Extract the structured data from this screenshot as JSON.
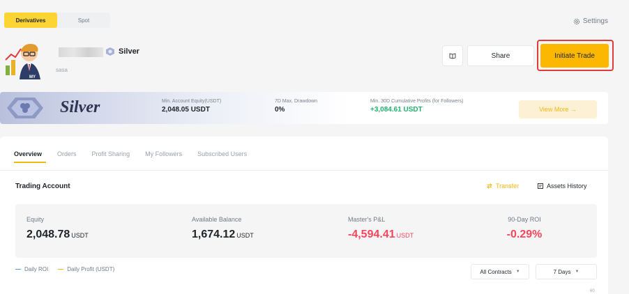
{
  "account_toggle": {
    "options": [
      "Derivatives",
      "Spot"
    ],
    "selected": "Derivatives"
  },
  "header": {
    "settings_label": "Settings",
    "user_tier": "Silver",
    "user_subname": "sasa",
    "avatar_tag": "MY",
    "share_label": "Share",
    "initiate_trade_label": "Initiate Trade"
  },
  "banner": {
    "tier_title": "Silver",
    "stats": [
      {
        "label": "Min. Account Equity(USDT)",
        "value": "2,048.05 USDT"
      },
      {
        "label": "7D Max. Drawdown",
        "value": "0%"
      },
      {
        "label": "Min. 30D Cumulative Profits (for Followers)",
        "value": "+3,084.61 USDT"
      }
    ],
    "view_more_label": "View More →"
  },
  "tabs": [
    "Overview",
    "Orders",
    "Profit Sharing",
    "My Followers",
    "Subscribed Users"
  ],
  "active_tab": "Overview",
  "trading_account": {
    "title": "Trading Account",
    "transfer_label": "Transfer",
    "assets_history_label": "Assets History",
    "metrics": [
      {
        "label": "Equity",
        "value": "2,048.78",
        "unit": "USDT"
      },
      {
        "label": "Available Balance",
        "value": "1,674.12",
        "unit": "USDT"
      },
      {
        "label": "Master's P&L",
        "value": "-4,594.41",
        "unit": "USDT"
      },
      {
        "label": "90-Day ROI",
        "value": "-0.29%",
        "unit": ""
      }
    ]
  },
  "chart_controls": {
    "legend": [
      {
        "label": "Daily ROI",
        "color": "#5b9bd5"
      },
      {
        "label": "Daily Profit (USDT)",
        "color": "#f0b90b"
      }
    ],
    "contracts_select": "All Contracts",
    "period_select": "7 Days",
    "y_tick": "60"
  },
  "colors": {
    "accent": "#fcb700",
    "positive": "#20b26c",
    "negative": "#f6465d",
    "highlight_box": "#e03a3a"
  }
}
